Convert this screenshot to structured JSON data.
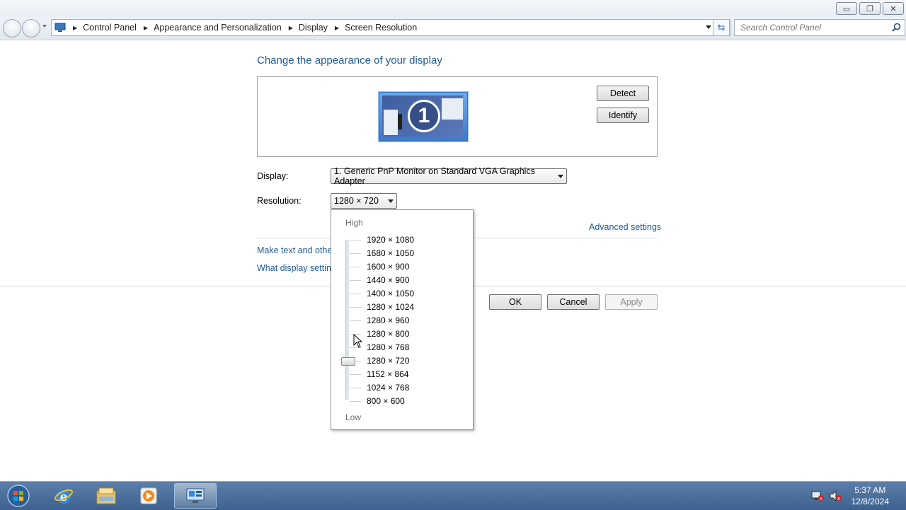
{
  "window": {
    "buttons": {
      "minimize": "▭",
      "restore": "❐",
      "close": "✕"
    }
  },
  "nav": {
    "breadcrumbs": [
      "Control Panel",
      "Appearance and Personalization",
      "Display",
      "Screen Resolution"
    ],
    "search_placeholder": "Search Control Panel"
  },
  "main": {
    "heading": "Change the appearance of your display",
    "monitor_number": "1",
    "detect_label": "Detect",
    "identify_label": "Identify",
    "display_label": "Display:",
    "display_value": "1. Generic PnP Monitor on Standard VGA Graphics Adapter",
    "resolution_label": "Resolution:",
    "resolution_value": "1280 × 720",
    "advanced_link": "Advanced settings",
    "link_make_text": "Make text and other",
    "link_what_display": "What display setting",
    "ok_label": "OK",
    "cancel_label": "Cancel",
    "apply_label": "Apply"
  },
  "dropdown": {
    "high_label": "High",
    "low_label": "Low",
    "options": [
      "1920 × 1080",
      "1680 × 1050",
      "1600 × 900",
      "1440 × 900",
      "1400 × 1050",
      "1280 × 1024",
      "1280 × 960",
      "1280 × 800",
      "1280 × 768",
      "1280 × 720",
      "1152 × 864",
      "1024 × 768",
      "800 × 600"
    ],
    "selected": "1280 × 720"
  },
  "taskbar": {
    "time": "5:37 AM",
    "date": "12/8/2024"
  },
  "colors": {
    "link": "#1e5a96",
    "taskbar": "#4a6f9c"
  }
}
